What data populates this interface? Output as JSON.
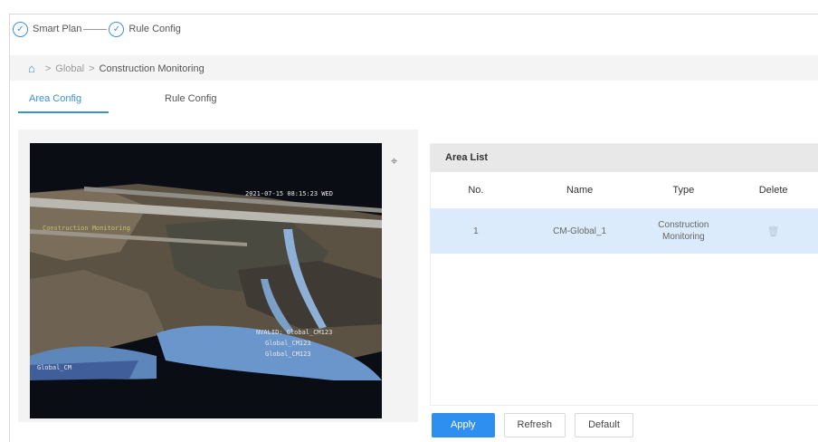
{
  "steps": [
    {
      "label": "Smart Plan"
    },
    {
      "label": "Rule Config"
    }
  ],
  "breadcrumb": {
    "items": [
      "Global",
      "Construction Monitoring"
    ]
  },
  "tabs": [
    {
      "label": "Area Config",
      "active": true
    },
    {
      "label": "Rule Config",
      "active": false
    }
  ],
  "video": {
    "timestamp": "2021-07-15 08:15:23 WED",
    "osd_left": "Construction Monitoring",
    "osd_right_1": "NVALID: Global_CM123",
    "osd_right_2": "Global_CM123",
    "osd_right_3": "Global_CM123",
    "osd_bottom_left": "Global_CM"
  },
  "area_list": {
    "title": "Area List",
    "columns": [
      "No.",
      "Name",
      "Type",
      "Delete"
    ],
    "rows": [
      {
        "no": "1",
        "name": "CM-Global_1",
        "type_line1": "Construction",
        "type_line2": "Monitoring"
      }
    ]
  },
  "buttons": {
    "apply": "Apply",
    "refresh": "Refresh",
    "default": "Default"
  },
  "colors": {
    "accent": "#2f8ff0",
    "selected_row": "#dcebfb"
  }
}
